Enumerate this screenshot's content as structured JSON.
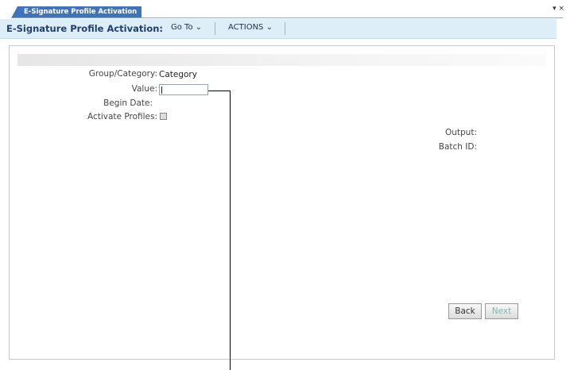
{
  "tab": {
    "label": "E-Signature Profile Activation",
    "controls": "▾ ×"
  },
  "toolbar": {
    "title": "E-Signature Profile Activation:",
    "goto_label": "Go To ⌄",
    "actions_label": "ACTIONS ⌄"
  },
  "form": {
    "group_label": "Group/Category:",
    "group_value": "Category",
    "value_label": "Value:",
    "value_input": "",
    "begin_date_label": "Begin Date:",
    "activate_label": "Activate Profiles:",
    "activate_checked": false,
    "output_label": "Output:",
    "batch_label": "Batch ID:"
  },
  "buttons": {
    "back": "Back",
    "next": "Next"
  }
}
